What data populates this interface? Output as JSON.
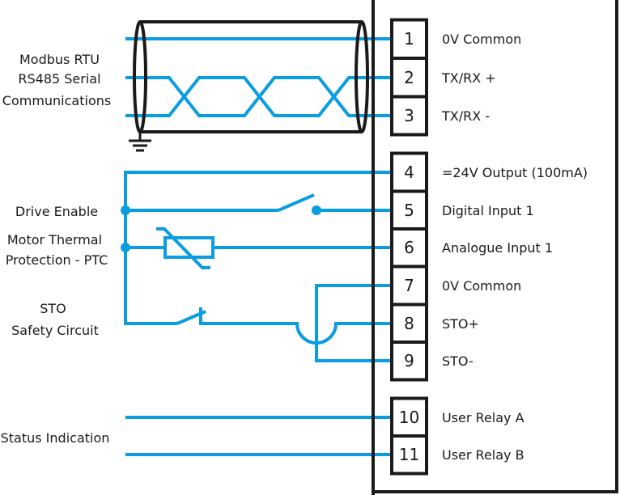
{
  "colors": {
    "wire": "#0a9de0",
    "outline": "#1a1a1a",
    "background": "#ffffff"
  },
  "left_labels": {
    "modbus": [
      "Modbus RTU",
      "RS485 Serial",
      "Communications"
    ],
    "drive_enable": "Drive Enable",
    "thermal": [
      "Motor Thermal",
      "Protection -  PTC"
    ],
    "sto": [
      "STO",
      "Safety Circuit"
    ],
    "status": "Status Indication"
  },
  "terminals": [
    {
      "number": "1",
      "label": "0V Common"
    },
    {
      "number": "2",
      "label": "TX/RX +"
    },
    {
      "number": "3",
      "label": "TX/RX -"
    },
    {
      "number": "4",
      "label": "=24V Output (100mA)"
    },
    {
      "number": "5",
      "label": "Digital Input 1"
    },
    {
      "number": "6",
      "label": "Analogue Input 1"
    },
    {
      "number": "7",
      "label": "0V Common"
    },
    {
      "number": "8",
      "label": "STO+"
    },
    {
      "number": "9",
      "label": "STO-"
    },
    {
      "number": "10",
      "label": "User Relay A"
    },
    {
      "number": "11",
      "label": "User Relay B"
    }
  ],
  "symbols": {
    "cable": "shielded-twisted-pair-icon",
    "ground": "ground-icon",
    "switch_no": "normally-open-switch-icon",
    "switch_nc": "normally-closed-switch-icon",
    "ptc": "ptc-thermistor-icon"
  }
}
